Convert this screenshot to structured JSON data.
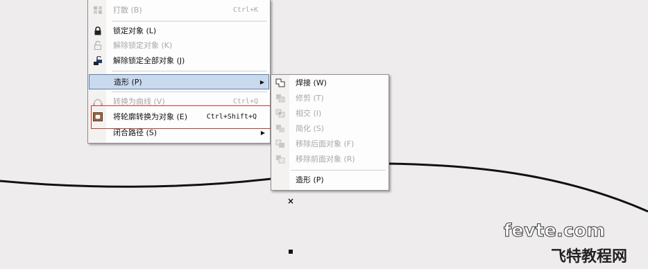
{
  "context_menu": {
    "items": [
      {
        "label": "打散 (B)",
        "shortcut": "Ctrl+K",
        "disabled": true,
        "icon": "break-apart-icon"
      },
      {
        "label": "锁定对象 (L)",
        "shortcut": "",
        "disabled": false,
        "icon": "lock-icon"
      },
      {
        "label": "解除锁定对象 (K)",
        "shortcut": "",
        "disabled": true,
        "icon": "unlock-icon"
      },
      {
        "label": "解除锁定全部对象 (J)",
        "shortcut": "",
        "disabled": false,
        "icon": "unlock-all-icon"
      },
      {
        "label": "造形 (P)",
        "shortcut": "",
        "disabled": false,
        "icon": ""
      },
      {
        "label": "转换为曲线 (V)",
        "shortcut": "Ctrl+Q",
        "disabled": true,
        "icon": "convert-to-curves-icon"
      },
      {
        "label": "将轮廓转换为对象 (E)",
        "shortcut": "Ctrl+Shift+Q",
        "disabled": false,
        "icon": "outline-to-object-icon"
      },
      {
        "label": "闭合路径 (S)",
        "shortcut": "",
        "disabled": false,
        "icon": ""
      }
    ],
    "highlighted_item": "造形 (P)"
  },
  "shaping_submenu": {
    "items": [
      {
        "label": "焊接 (W)",
        "disabled": false,
        "icon": "weld-icon"
      },
      {
        "label": "修剪 (T)",
        "disabled": true,
        "icon": "trim-icon"
      },
      {
        "label": "相交 (I)",
        "disabled": true,
        "icon": "intersect-icon"
      },
      {
        "label": "简化 (S)",
        "disabled": true,
        "icon": "simplify-icon"
      },
      {
        "label": "移除后面对象 (F)",
        "disabled": true,
        "icon": "front-minus-back-icon"
      },
      {
        "label": "移除前面对象 (R)",
        "disabled": true,
        "icon": "back-minus-front-icon"
      },
      {
        "label": "造形 (P)",
        "disabled": false,
        "icon": ""
      }
    ]
  },
  "watermark": {
    "top": "fevte.com",
    "bottom": "飞特教程网"
  },
  "colors": {
    "canvas": "#efeced",
    "highlight": "#c9d9ee",
    "callout_border": "#c0392b"
  }
}
